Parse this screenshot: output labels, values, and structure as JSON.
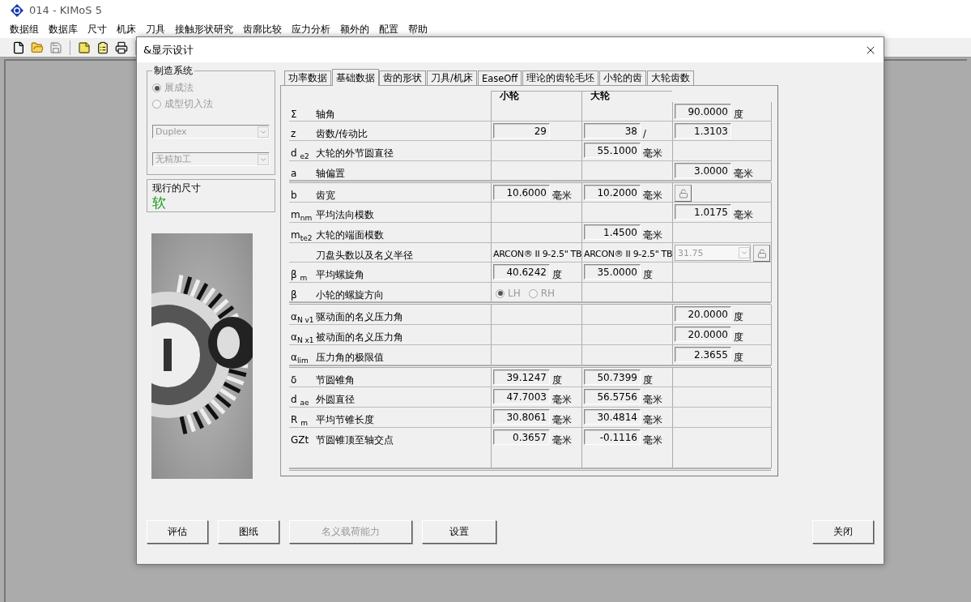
{
  "app": {
    "title": "014 - KIMoS 5",
    "menu": [
      "数据组",
      "数据库",
      "尺寸",
      "机床",
      "刀具",
      "接触形状研究",
      "齿廓比较",
      "应力分析",
      "额外的",
      "配置",
      "帮助"
    ]
  },
  "dialog": {
    "title": "&显示设计",
    "manufacturing": {
      "title": "制造系统",
      "disabled": true,
      "options": [
        {
          "label": "展成法",
          "selected": true
        },
        {
          "label": "成型切入法",
          "selected": false
        }
      ],
      "combos": [
        "Duplex",
        "无精加工"
      ]
    },
    "current_size": {
      "label": "现行的尺寸",
      "value": "软"
    },
    "tabs": [
      {
        "label": "功率数据",
        "selected": false
      },
      {
        "label": "基础数据",
        "selected": true
      },
      {
        "label": "齿的形状",
        "selected": false
      },
      {
        "label": "刀具/机床",
        "selected": false
      },
      {
        "label": "EaseOff",
        "selected": false
      },
      {
        "label": "理论的齿轮毛坯",
        "selected": false
      },
      {
        "label": "小轮的齿",
        "selected": false
      },
      {
        "label": "大轮齿数",
        "selected": false
      }
    ],
    "columns": [
      "小轮",
      "大轮"
    ],
    "groups": [
      {
        "rows": [
          {
            "symbol": "Σ",
            "label": "轴角",
            "cells": [
              {
                "kind": "empty"
              },
              {
                "kind": "empty"
              },
              {
                "kind": "field",
                "value": "90.0000",
                "unit": "度"
              }
            ]
          },
          {
            "symbol": "z",
            "label": "齿数/传动比",
            "cells": [
              {
                "kind": "field",
                "value": "29"
              },
              {
                "kind": "field",
                "value": "38",
                "unit": "/"
              },
              {
                "kind": "field",
                "value": "1.3103"
              }
            ]
          },
          {
            "symbol": "d $_{e2}$",
            "label": "大轮的外节圆直径",
            "cells": [
              {
                "kind": "empty"
              },
              {
                "kind": "field",
                "value": "55.1000",
                "unit": "毫米"
              },
              {
                "kind": "empty"
              }
            ]
          },
          {
            "symbol": "a",
            "label": "轴偏置",
            "cells": [
              {
                "kind": "empty"
              },
              {
                "kind": "empty"
              },
              {
                "kind": "field",
                "value": "3.0000",
                "unit": "毫米"
              }
            ]
          }
        ]
      },
      {
        "rows": [
          {
            "symbol": "b",
            "label": "齿宽",
            "cells": [
              {
                "kind": "field",
                "value": "10.6000",
                "unit": "毫米"
              },
              {
                "kind": "field",
                "value": "10.2000",
                "unit": "毫米"
              },
              {
                "kind": "lock"
              }
            ]
          },
          {
            "symbol": "m$_{nm}$",
            "label": "平均法向模数",
            "cells": [
              {
                "kind": "empty"
              },
              {
                "kind": "empty"
              },
              {
                "kind": "field",
                "value": "1.0175",
                "unit": "毫米"
              }
            ]
          },
          {
            "symbol": "m$_{te2}$",
            "label": "大轮的端面模数",
            "cells": [
              {
                "kind": "empty"
              },
              {
                "kind": "field",
                "value": "1.4500",
                "unit": "毫米"
              },
              {
                "kind": "empty"
              }
            ]
          },
          {
            "label": "刀盘头数以及名义半径",
            "cells": [
              {
                "kind": "text",
                "value": "ARCON® II 9-2.5\" TB"
              },
              {
                "kind": "text",
                "value": "ARCON® II 9-2.5\" TB"
              },
              {
                "kind": "combo",
                "value": "31.75",
                "disabled": true
              }
            ]
          },
          {
            "symbol": "β $_{m}$",
            "label": "平均螺旋角",
            "cells": [
              {
                "kind": "field",
                "value": "40.6242",
                "unit": "度"
              },
              {
                "kind": "field",
                "value": "35.0000",
                "unit": "度"
              },
              {
                "kind": "empty"
              }
            ]
          },
          {
            "symbol": "β",
            "label": "小轮的螺旋方向",
            "cells": [
              {
                "kind": "radios",
                "disabled": true,
                "options": [
                  {
                    "label": "LH",
                    "selected": true
                  },
                  {
                    "label": "RH",
                    "selected": false
                  }
                ]
              },
              {
                "kind": "empty"
              },
              {
                "kind": "empty"
              }
            ]
          }
        ]
      },
      {
        "rows": [
          {
            "symbol": "α$_{N v1}$",
            "label": "驱动面的名义压力角",
            "cells": [
              {
                "kind": "empty"
              },
              {
                "kind": "empty"
              },
              {
                "kind": "field",
                "value": "20.0000",
                "unit": "度"
              }
            ]
          },
          {
            "symbol": "α$_{N x1}$",
            "label": "被动面的名义压力角",
            "cells": [
              {
                "kind": "empty"
              },
              {
                "kind": "empty"
              },
              {
                "kind": "field",
                "value": "20.0000",
                "unit": "度"
              }
            ]
          },
          {
            "symbol": "α$_{lim}$",
            "label": "压力角的极限值",
            "cells": [
              {
                "kind": "empty"
              },
              {
                "kind": "empty"
              },
              {
                "kind": "field",
                "value": "2.3655",
                "unit": "度"
              }
            ]
          }
        ]
      },
      {
        "rows": [
          {
            "symbol": "δ",
            "label": "节圆锥角",
            "cells": [
              {
                "kind": "field",
                "value": "39.1247",
                "unit": "度"
              },
              {
                "kind": "field",
                "value": "50.7399",
                "unit": "度"
              },
              {
                "kind": "empty"
              }
            ]
          },
          {
            "symbol": "d $_{ae}$",
            "label": "外圆直径",
            "cells": [
              {
                "kind": "field",
                "value": "47.7003",
                "unit": "毫米"
              },
              {
                "kind": "field",
                "value": "56.5756",
                "unit": "毫米"
              },
              {
                "kind": "empty"
              }
            ]
          },
          {
            "symbol": "R $_{m}$",
            "label": "平均节锥长度",
            "cells": [
              {
                "kind": "field",
                "value": "30.8061",
                "unit": "毫米"
              },
              {
                "kind": "field",
                "value": "30.4814",
                "unit": "毫米"
              },
              {
                "kind": "empty"
              }
            ]
          },
          {
            "symbol": "GZt",
            "label": "节圆锥顶至轴交点",
            "cells": [
              {
                "kind": "field",
                "value": "0.3657",
                "unit": "毫米"
              },
              {
                "kind": "field",
                "value": "-0.1116",
                "unit": "毫米"
              },
              {
                "kind": "empty"
              }
            ]
          }
        ]
      }
    ],
    "buttons": [
      {
        "label": "评估",
        "disabled": false
      },
      {
        "label": "图纸",
        "disabled": false
      },
      {
        "label": "名义载荷能力",
        "disabled": true
      },
      {
        "label": "设置",
        "disabled": false
      }
    ],
    "close_button": "关闭"
  }
}
